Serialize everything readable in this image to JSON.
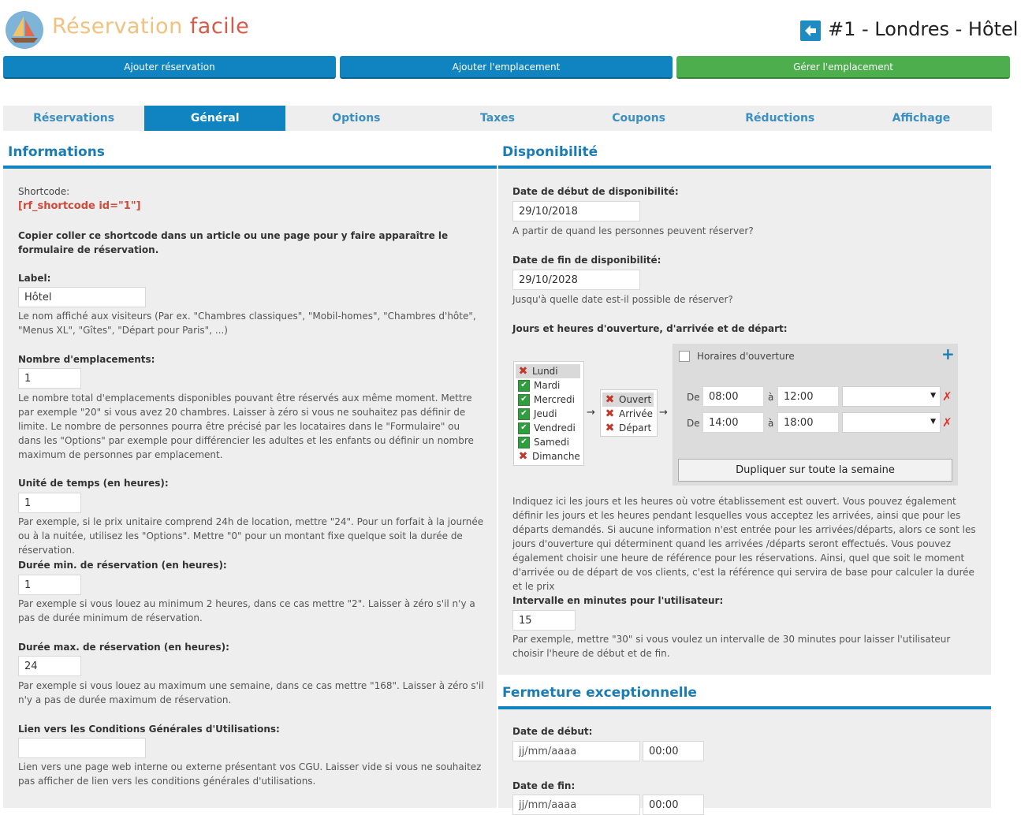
{
  "brand": {
    "word1": "Réservation",
    "word2": "facile"
  },
  "header": {
    "location_title": "#1 - Londres - Hôtel"
  },
  "toolbar": {
    "add_reservation": "Ajouter réservation",
    "add_location": "Ajouter l'emplacement",
    "manage_location": "Gérer l'emplacement"
  },
  "tabs": [
    "Réservations",
    "Général",
    "Options",
    "Taxes",
    "Coupons",
    "Réductions",
    "Affichage"
  ],
  "active_tab": "Général",
  "informations": {
    "title": "Informations",
    "shortcode_label": "Shortcode:",
    "shortcode_value": "[rf_shortcode id=\"1\"]",
    "shortcode_help": "Copier coller ce shortcode dans un article ou une page pour y faire apparaître le formulaire de réservation.",
    "label_label": "Label:",
    "label_value": "Hôtel",
    "label_help": "Le nom affiché aux visiteurs (Par ex. \"Chambres classiques\", \"Mobil-homes\", \"Chambres d'hôte\", \"Menus XL\", \"Gîtes\", \"Départ pour Paris\", ...)",
    "count_label": "Nombre d'emplacements:",
    "count_value": "1",
    "count_help": "Le nombre total d'emplacements disponibles pouvant être réservés aux même moment. Mettre par exemple \"20\" si vous avez 20 chambres. Laisser à zéro si vous ne souhaitez pas définir de limite. Le nombre de personnes pourra être précisé par les locataires dans le \"Formulaire\" ou dans les \"Options\" par exemple pour différencier les adultes et les enfants ou définir un nombre maximum de personnes par emplacement.",
    "unit_label": "Unité de temps (en heures):",
    "unit_value": "1",
    "unit_help": "Par exemple, si le prix unitaire comprend 24h de location, mettre \"24\". Pour un forfait à la journée ou à la nuitée, utilisez les \"Options\". Mettre \"0\" pour un montant fixe quelque soit la durée de réservation.",
    "min_label": "Durée min. de réservation (en heures):",
    "min_value": "1",
    "min_help": "Par exemple si vous louez au minimum 2 heures, dans ce cas mettre \"2\". Laisser à zéro s'il n'y a pas de durée minimum de réservation.",
    "max_label": "Durée max. de réservation (en heures):",
    "max_value": "24",
    "max_help": "Par exemple si vous louez au maximum une semaine, dans ce cas mettre \"168\". Laisser à zéro s'il n'y a pas de durée maximum de réservation.",
    "cgu_label": "Lien vers les Conditions Générales d'Utilisations:",
    "cgu_value": "",
    "cgu_help": "Lien vers une page web interne ou externe présentant vos CGU. Laisser vide si vous ne souhaitez pas afficher de lien vers les conditions générales d'utilisations."
  },
  "disponibilite": {
    "title": "Disponibilité",
    "start_label": "Date de début de disponibilité:",
    "start_value": "29/10/2018",
    "start_help": "A partir de quand les personnes peuvent réserver?",
    "end_label": "Date de fin de disponibilité:",
    "end_value": "29/10/2028",
    "end_help": "Jusqu'à quelle date est-il possible de réserver?",
    "days_label": "Jours et heures d'ouverture, d'arrivée et de départ:",
    "days": [
      {
        "name": "Lundi",
        "checked": false,
        "selected": true
      },
      {
        "name": "Mardi",
        "checked": true,
        "selected": false
      },
      {
        "name": "Mercredi",
        "checked": true,
        "selected": false
      },
      {
        "name": "Jeudi",
        "checked": true,
        "selected": false
      },
      {
        "name": "Vendredi",
        "checked": true,
        "selected": false
      },
      {
        "name": "Samedi",
        "checked": true,
        "selected": false
      },
      {
        "name": "Dimanche",
        "checked": false,
        "selected": false
      }
    ],
    "day_types": [
      {
        "name": "Ouvert",
        "selected": true
      },
      {
        "name": "Arrivée",
        "selected": false
      },
      {
        "name": "Départ",
        "selected": false
      }
    ],
    "arrow_glyph": "→",
    "hours_checkbox_label": "Horaires d'ouverture",
    "add_glyph": "+",
    "time_slots": [
      {
        "from_label": "De",
        "from": "08:00",
        "to_label": "à",
        "to": "12:00",
        "select": ""
      },
      {
        "from_label": "De",
        "from": "14:00",
        "to_label": "à",
        "to": "18:00",
        "select": ""
      }
    ],
    "remove_glyph": "✗",
    "duplicate_button": "Dupliquer sur toute la semaine",
    "days_help": "Indiquez ici les jours et les heures où votre établissement est ouvert. Vous pouvez également définir les jours et les heures pendant lesquelles vous acceptez les arrivées, ainsi que pour les départs demandés. Si aucune information n'est entrée pour les arrivées/départs, alors ce sont les jours d'ouverture qui déterminent quand les arrivées /départs seront effectués. Vous pouvez également choisir une heure de référence pour les réservations. Ainsi, quel que soit le moment d'arrivée ou de départ de vos clients, c'est la référence qui servira de base pour calculer la durée et le prix",
    "interval_label": "Intervalle en minutes pour l'utilisateur:",
    "interval_value": "15",
    "interval_help": "Par exemple, mettre \"30\" si vous voulez un intervalle de 30 minutes pour laisser l'utilisateur choisir l'heure de début et de fin."
  },
  "fermeture": {
    "title": "Fermeture exceptionnelle",
    "start_label": "Date de début:",
    "start_date_placeholder": "jj/mm/aaaa",
    "start_time": "00:00",
    "end_label": "Date de fin:",
    "end_date_placeholder": "jj/mm/aaaa",
    "end_time": "00:00"
  },
  "colors": {
    "accent": "#0f84c0",
    "green": "#4cae4c",
    "brand_gold": "#f0c27e",
    "brand_red": "#d65a4a",
    "shortcode_red": "#d04a3a"
  }
}
